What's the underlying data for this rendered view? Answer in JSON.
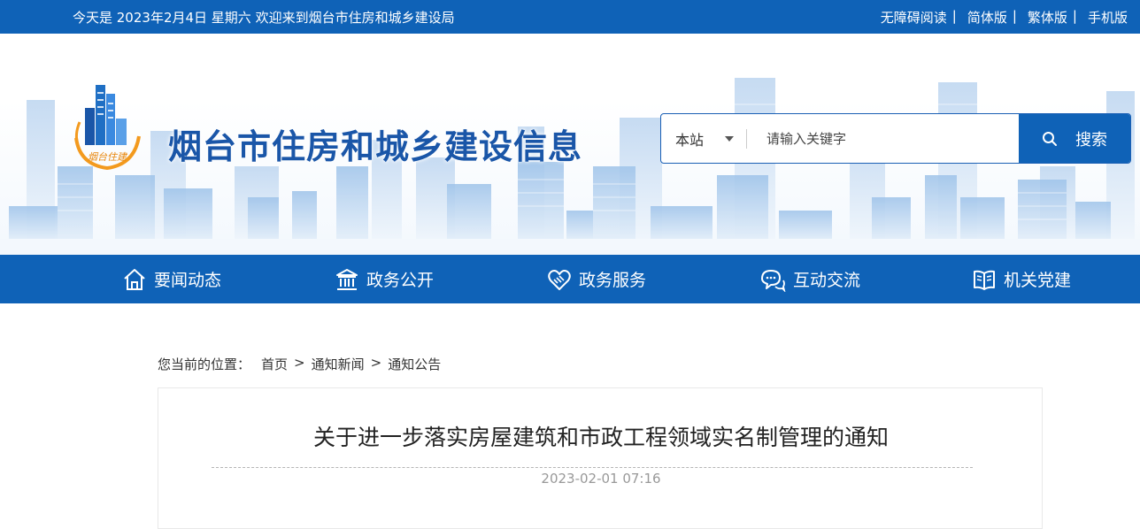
{
  "topbar": {
    "greeting": "今天是 2023年2月4日 星期六 欢迎来到烟台市住房和城乡建设局",
    "links": [
      {
        "label": "无障碍阅读",
        "sep": "|"
      },
      {
        "label": "简体版",
        "sep": "|"
      },
      {
        "label": "繁体版",
        "sep": "|"
      },
      {
        "label": "手机版"
      }
    ]
  },
  "header": {
    "logo_text": "烟台住建",
    "site_title": "烟台市住房和城乡建设信息"
  },
  "search": {
    "scope": "本站",
    "placeholder": "请输入关键字",
    "button_label": "搜索"
  },
  "nav": {
    "items": [
      {
        "label": "要闻动态",
        "icon": "home-icon"
      },
      {
        "label": "政务公开",
        "icon": "government-building-icon"
      },
      {
        "label": "政务服务",
        "icon": "handshake-heart-icon"
      },
      {
        "label": "互动交流",
        "icon": "chat-bubbles-icon"
      },
      {
        "label": "机关党建",
        "icon": "open-book-icon"
      }
    ]
  },
  "breadcrumb": {
    "label": "您当前的位置：",
    "items": [
      "首页",
      "通知新闻",
      "通知公告"
    ],
    "arrow": ">"
  },
  "article": {
    "title": "关于进一步落实房屋建筑和市政工程领域实名制管理的通知",
    "date": "2023-02-01 07:16"
  },
  "colors": {
    "primary_blue": "#0f62b7",
    "title_blue": "#1a56a8",
    "logo_orange": "#f39a1e"
  }
}
